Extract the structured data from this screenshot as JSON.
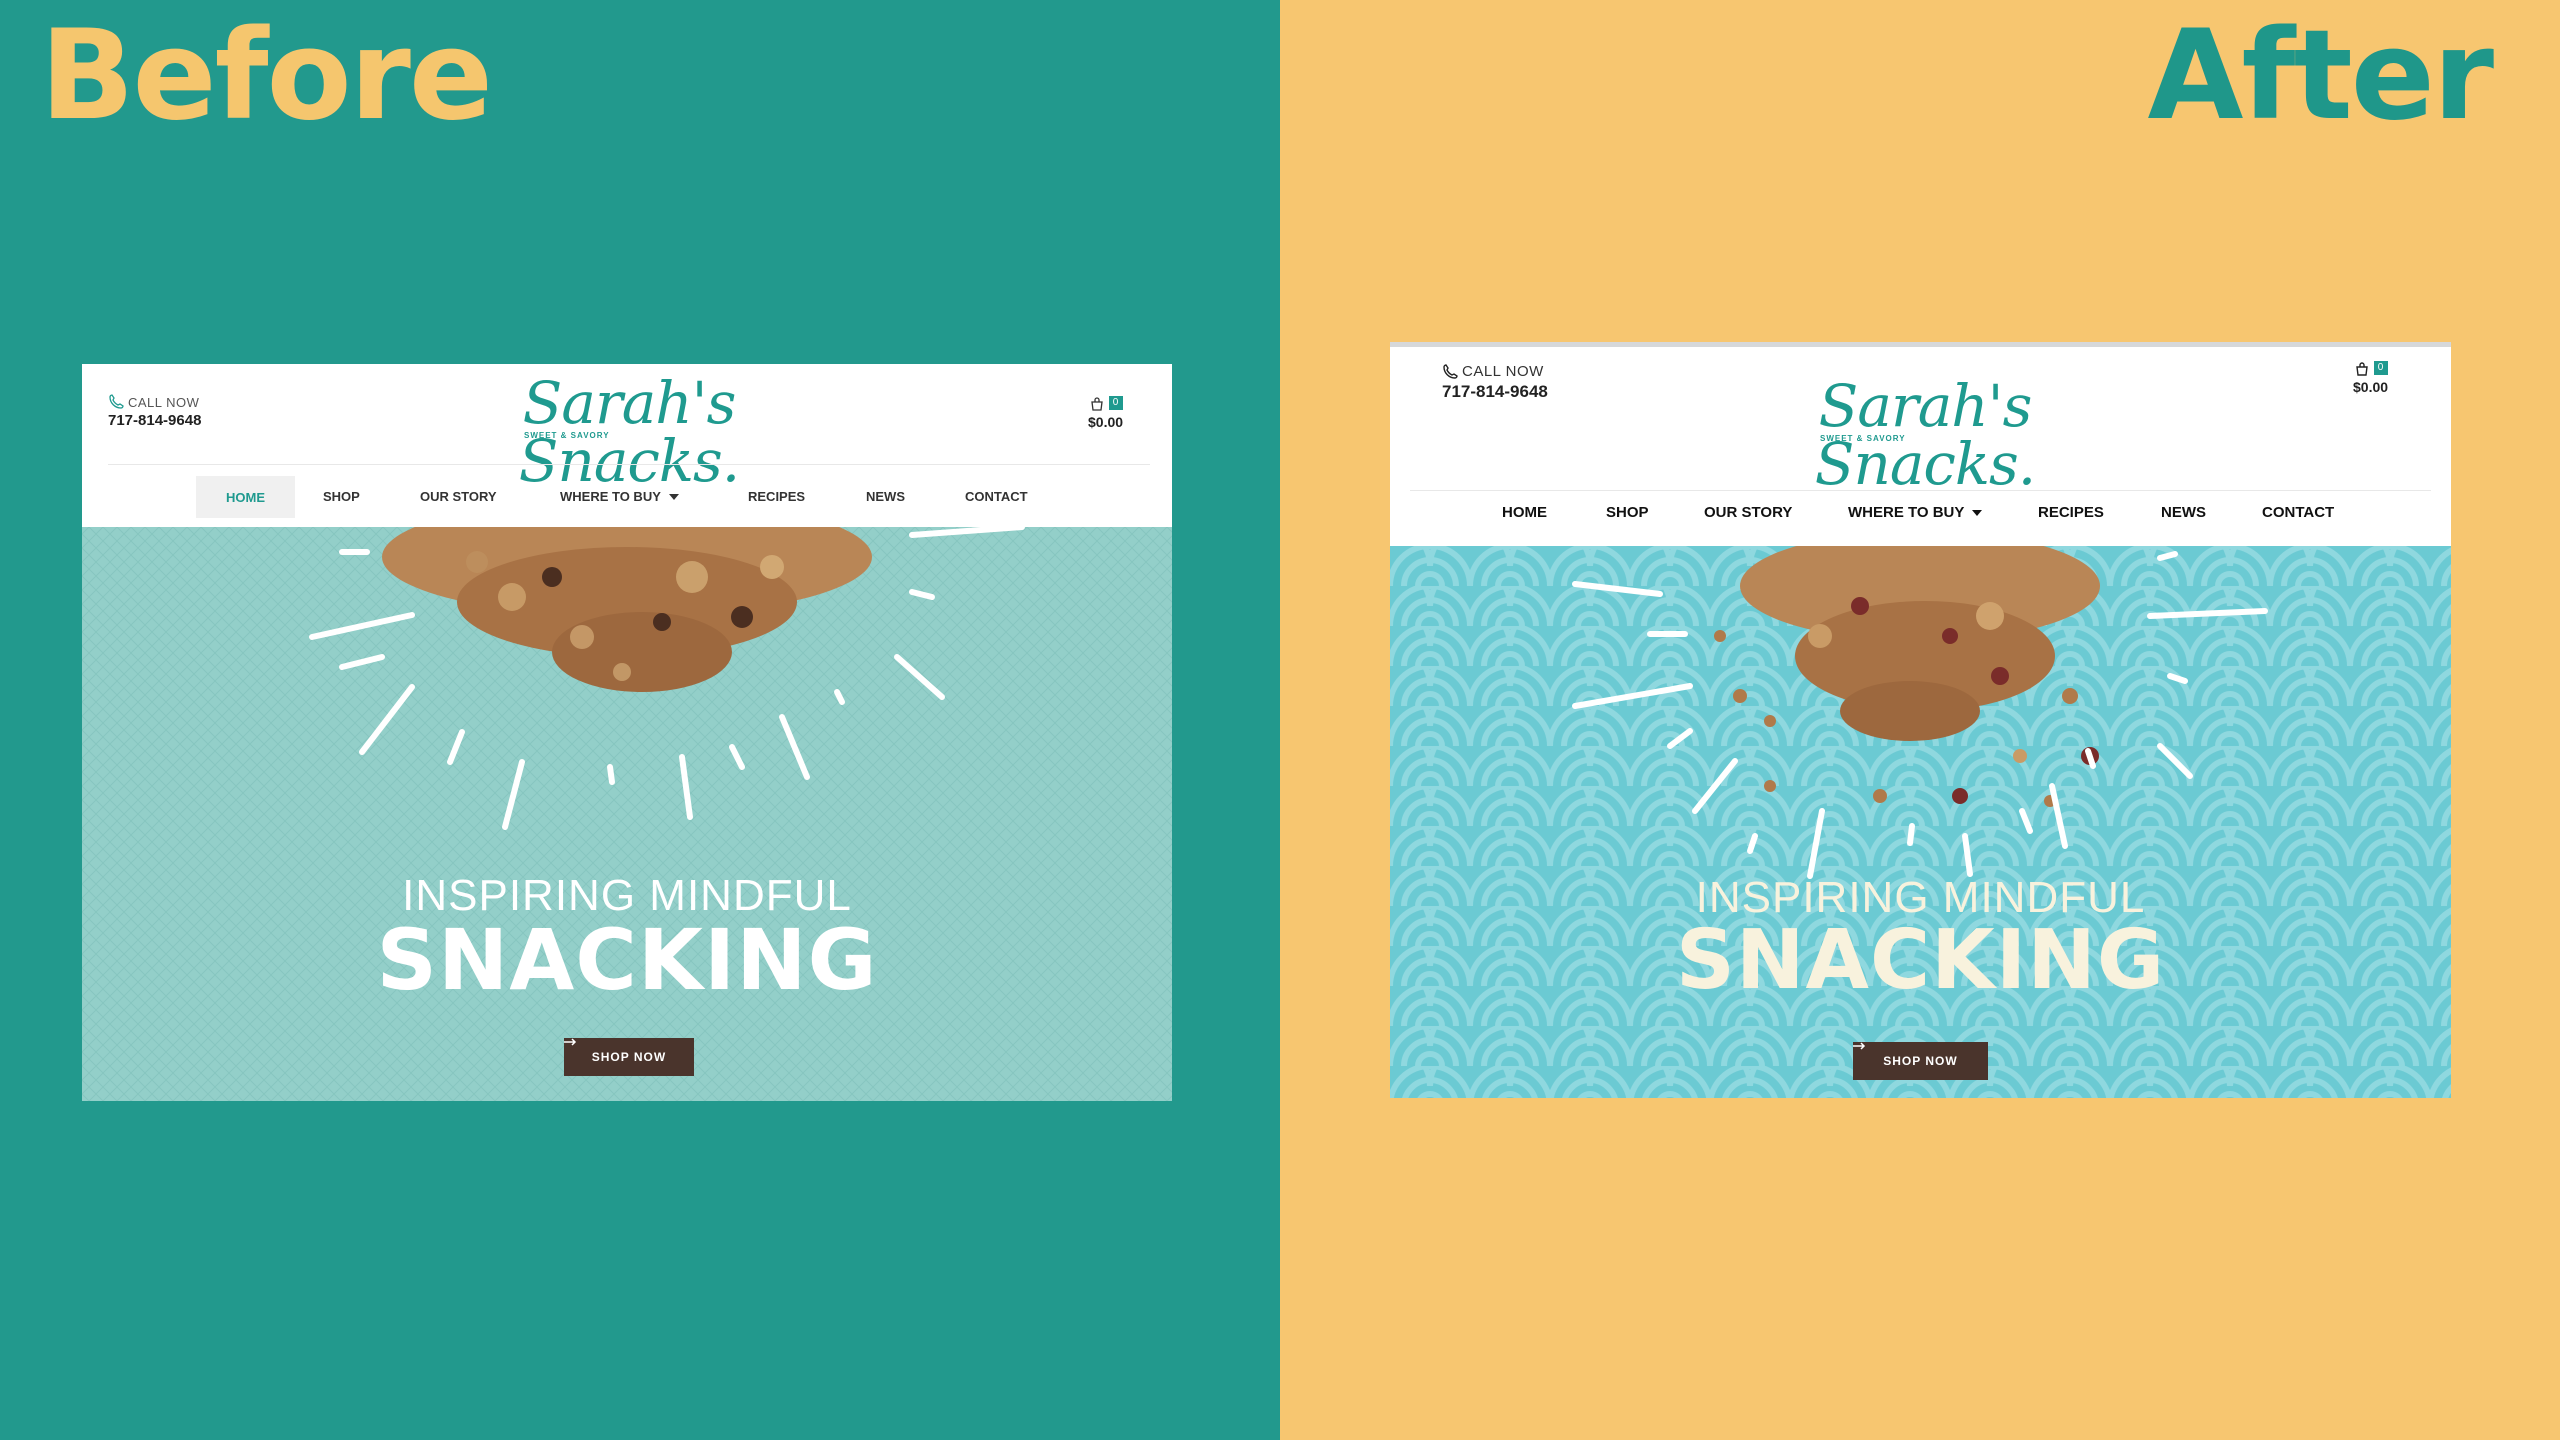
{
  "colors": {
    "before_bg": "#22998d",
    "after_bg": "#f7c670",
    "before_label": "#f5c66e",
    "after_label": "#1f978a",
    "brand_teal": "#1f9a8f",
    "before_hero": "#93cfc9",
    "after_hero": "#6bcad3",
    "cta_brown": "#4a342c",
    "after_snacking": "#f8f2dd"
  },
  "labels": {
    "before": "Before",
    "after": "After"
  },
  "before_site": {
    "call_label": "CALL NOW",
    "phone": "717-814-9648",
    "logo_text": "Sarah's Snacks.",
    "logo_subtitle": "SWEET & SAVORY",
    "cart_count": "0",
    "cart_total": "$0.00",
    "nav": [
      {
        "label": "HOME",
        "active": true
      },
      {
        "label": "SHOP"
      },
      {
        "label": "OUR STORY"
      },
      {
        "label": "WHERE TO BUY",
        "dropdown": true
      },
      {
        "label": "RECIPES"
      },
      {
        "label": "NEWS"
      },
      {
        "label": "CONTACT"
      }
    ],
    "tagline": "INSPIRING MINDFUL",
    "headline": "SNACKING",
    "cta": "SHOP NOW"
  },
  "after_site": {
    "call_label": "CALL NOW",
    "phone": "717-814-9648",
    "logo_text": "Sarah's Snacks.",
    "logo_subtitle": "SWEET & SAVORY",
    "cart_count": "0",
    "cart_total": "$0.00",
    "nav": [
      {
        "label": "HOME"
      },
      {
        "label": "SHOP"
      },
      {
        "label": "OUR STORY"
      },
      {
        "label": "WHERE TO BUY",
        "dropdown": true
      },
      {
        "label": "RECIPES"
      },
      {
        "label": "NEWS"
      },
      {
        "label": "CONTACT"
      }
    ],
    "tagline": "INSPIRING MINDFUL",
    "headline": "SNACKING",
    "cta": "SHOP NOW"
  },
  "icons": [
    "phone-icon",
    "cart-icon",
    "arrow-right-icon",
    "chevron-down-icon"
  ]
}
